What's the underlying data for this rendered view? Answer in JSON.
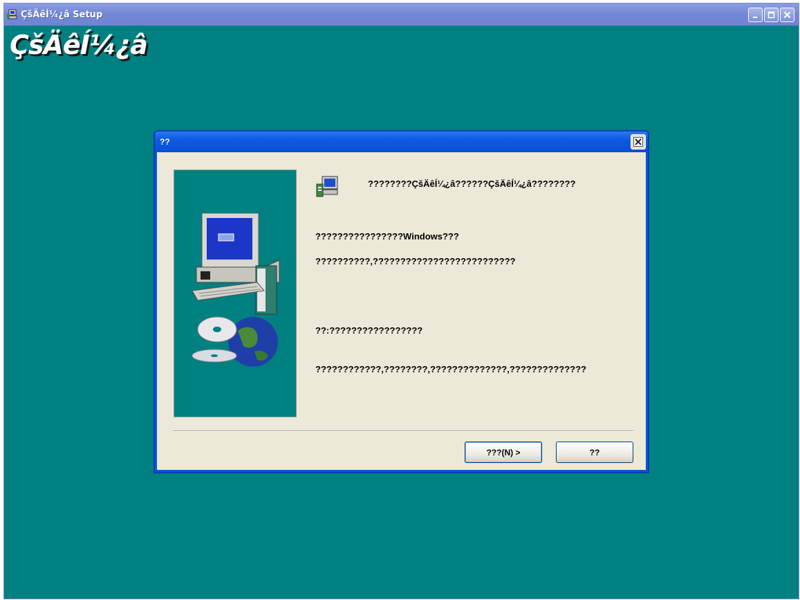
{
  "window": {
    "title": "ÇšÄêÍ¼¿â Setup",
    "big_title": "ÇšÄêÍ¼¿â",
    "controls": [
      "minimize",
      "maximize",
      "close"
    ],
    "background_color": "#008080"
  },
  "dialog": {
    "title": "??",
    "messages": [
      "????????ÇšÄêÍ¼¿â??????ÇšÄêÍ¼¿â????????",
      "????????????????Windows???",
      "??????????,??????????????????????????",
      "??:?????????????????",
      "????????????,????????,??????????????,??????????????"
    ],
    "buttons": {
      "next_label": "???(N) >",
      "cancel_label": "??"
    }
  },
  "icons": {
    "app_icon": "setup-computer-icon",
    "dialog_icon": "setup-computer-icon",
    "side_art": "computer-with-cds-illustration"
  }
}
